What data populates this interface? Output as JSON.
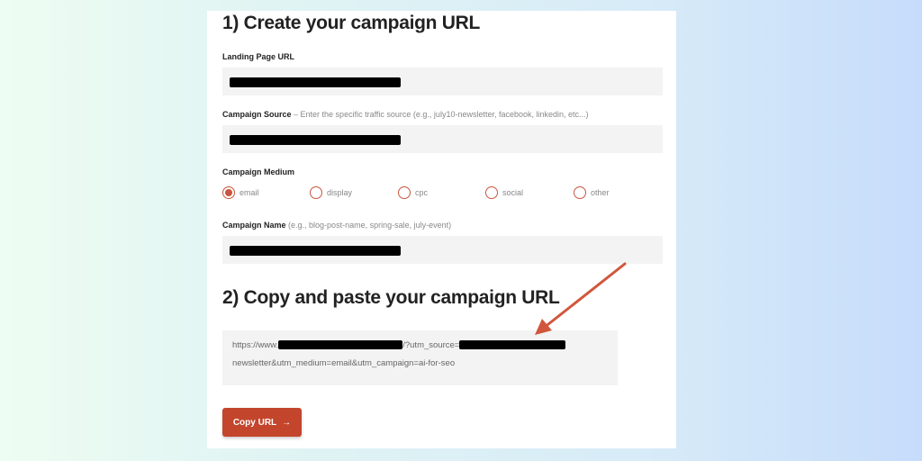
{
  "section1": {
    "title": "1) Create your campaign URL"
  },
  "landing": {
    "label": "Landing Page URL"
  },
  "source": {
    "label": "Campaign Source",
    "hint": " – Enter the specific traffic source (e.g., july10-newsletter, facebook, linkedin, etc...)"
  },
  "medium": {
    "label": "Campaign Medium",
    "options": [
      {
        "label": "email",
        "selected": true
      },
      {
        "label": "display",
        "selected": false
      },
      {
        "label": "cpc",
        "selected": false
      },
      {
        "label": "social",
        "selected": false
      },
      {
        "label": "other",
        "selected": false
      }
    ]
  },
  "name": {
    "label": "Campaign Name",
    "hint": " (e.g., blog-post-name, spring-sale, july-event)"
  },
  "section2": {
    "title": "2) Copy and paste your campaign URL"
  },
  "output": {
    "line1_start": "https://www.",
    "line1_mid": "/?utm_source=",
    "line2": "newsletter&utm_medium=email&utm_campaign=ai-for-seo"
  },
  "button": {
    "label": "Copy URL",
    "icon": "arrow-right-icon"
  },
  "colors": {
    "accent": "#c3452c",
    "arrow": "#d0573c"
  }
}
